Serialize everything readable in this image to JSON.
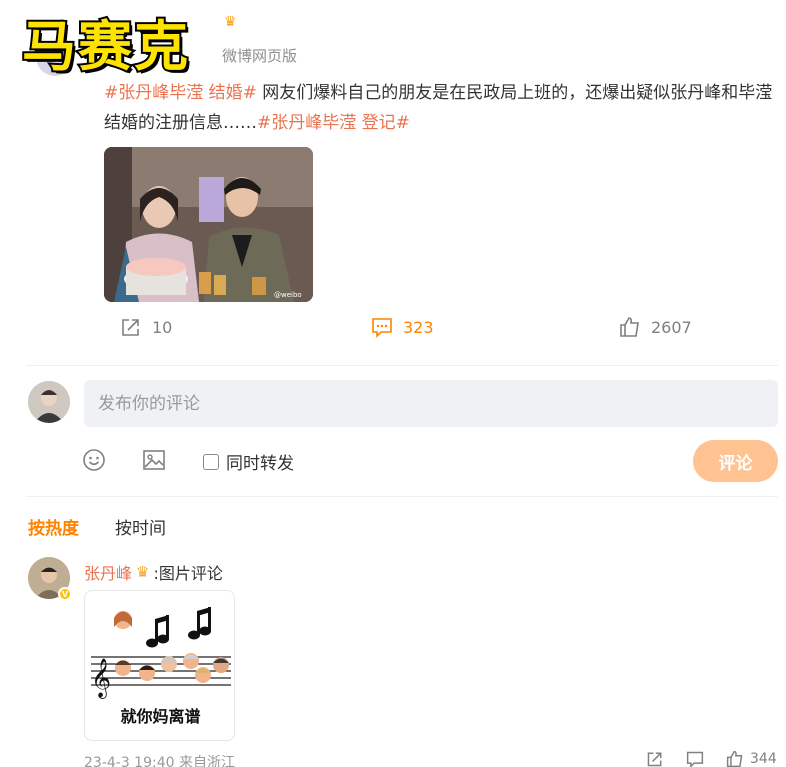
{
  "watermark": "马赛克",
  "post": {
    "source": "微博网页版",
    "segments": [
      {
        "text": "#张丹峰毕滢 结婚#",
        "type": "topic"
      },
      {
        "text": " 网友们爆料自己的朋友是在民政局上班的，还爆出疑似张丹峰和毕滢结婚的注册信息……",
        "type": "text"
      },
      {
        "text": "#张丹峰毕滢 登记#",
        "type": "topic"
      }
    ],
    "reposts": "10",
    "comments": "323",
    "likes": "2607"
  },
  "composer": {
    "placeholder": "发布你的评论",
    "forward_label": "同时转发",
    "submit_label": "评论"
  },
  "sort": {
    "hot_label": "按热度",
    "time_label": "按时间"
  },
  "comment": {
    "username": "张丹峰",
    "text": ":图片评论",
    "image_caption": "就你妈离谱",
    "meta": "23-4-3 19:40 来自浙江",
    "likes": "344"
  },
  "colors": {
    "topic": "#eb7350",
    "accent": "#ff8200",
    "submit_disabled": "#ffc391",
    "input_bg": "#f0f1f4"
  },
  "icons": [
    "repost-icon",
    "comment-icon",
    "like-icon",
    "emoji-icon",
    "image-icon",
    "crown-icon",
    "verified-icon"
  ]
}
